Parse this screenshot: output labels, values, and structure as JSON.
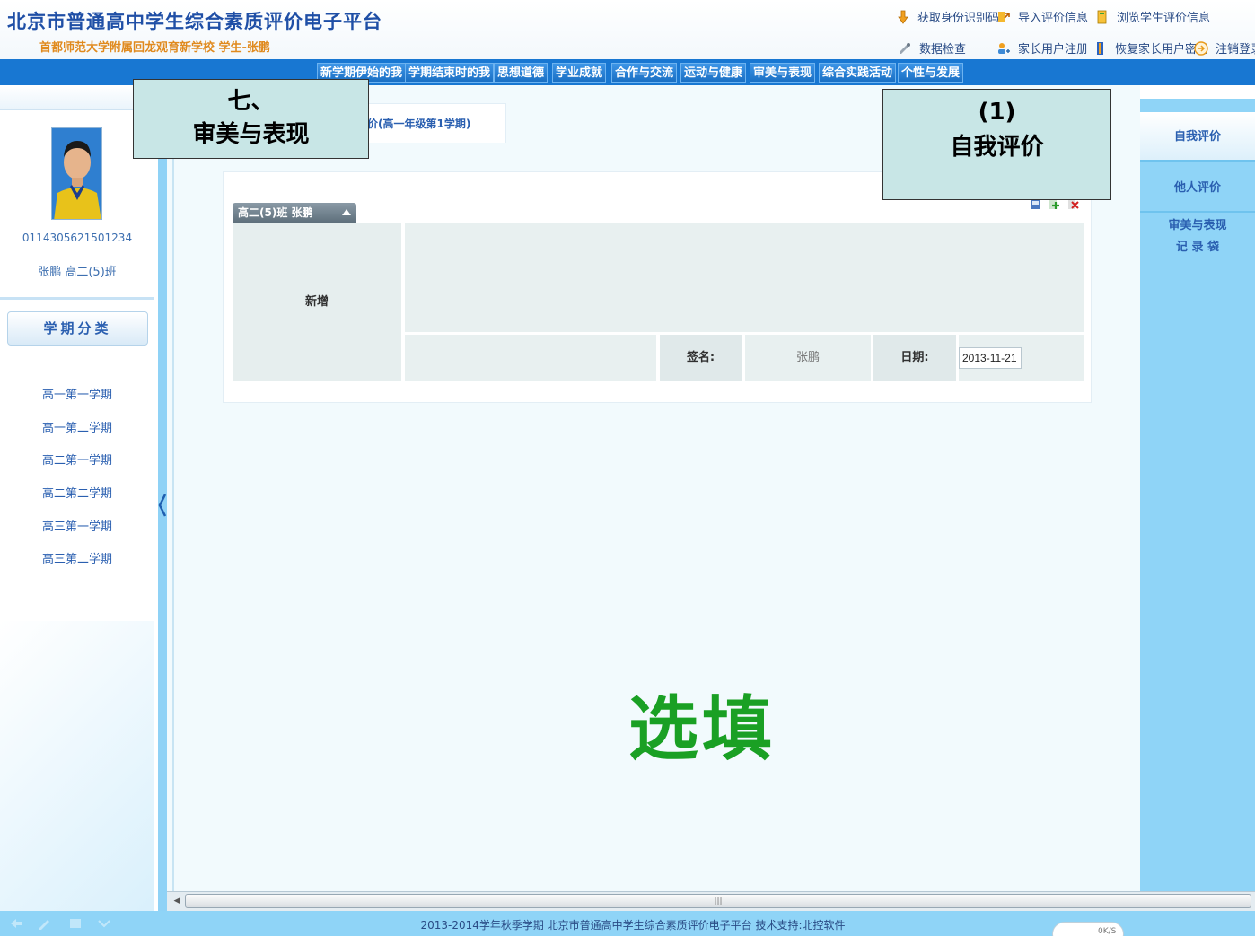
{
  "header": {
    "site_title": "北京市普通高中学生综合素质评价电子平台",
    "subtitle": "首都师范大学附属回龙观育新学校 学生-张鹏",
    "links": [
      {
        "label": "获取身份识别码",
        "icon": "hand-down-icon"
      },
      {
        "label": "导入评价信息",
        "icon": "import-icon"
      },
      {
        "label": "浏览学生评价信息",
        "icon": "book-icon"
      },
      {
        "label": "数据检查",
        "icon": "pen-check-icon"
      },
      {
        "label": "家长用户注册",
        "icon": "user-register-icon"
      },
      {
        "label": "恢复家长用户密码",
        "icon": "key-book-icon"
      },
      {
        "label": "注销登录",
        "icon": "logout-icon"
      }
    ]
  },
  "nav": {
    "items": [
      "新学期伊始的我",
      "学期结束时的我",
      "思想道德",
      "学业成就",
      "合作与交流",
      "运动与健康",
      "审美与表现",
      "综合实践活动",
      "个性与发展"
    ]
  },
  "student": {
    "id": "0114305621501234",
    "name_class": "张鹏 高二(5)班"
  },
  "term_category": {
    "title": "学期分类",
    "items": [
      "高一第一学期",
      "高一第二学期",
      "高二第一学期",
      "高二第二学期",
      "高三第一学期",
      "高三第二学期"
    ]
  },
  "main": {
    "tab_label": "价(高一年级第1学期)",
    "record_title": "高二(5)班 张鹏",
    "tool_icons": [
      "save-icon",
      "add-icon",
      "delete-icon"
    ],
    "new_label": "新增",
    "sign_label": "签名:",
    "sign_value": "张鹏",
    "date_label": "日期:",
    "date_value": "2013-11-21",
    "optional_note": "选填"
  },
  "right_sidebar": {
    "items": [
      "自我评价",
      "他人评价",
      "审美与表现",
      "记 录 袋"
    ]
  },
  "footer": {
    "text": "2013-2014学年秋季学期 北京市普通高中学生综合素质评价电子平台 技术支持:北控软件",
    "speed": "0K/S"
  },
  "callouts": {
    "category_line1": "七、",
    "category_line2": "审美与表现",
    "sub_line1": "(1)",
    "sub_line2": "自我评价"
  },
  "colors": {
    "nav_blue": "#1877d2",
    "sidebar_blue": "#8fd4f7",
    "link_blue": "#2a5fb0",
    "note_green": "#1aa024",
    "callout_bg": "#c8e6e6"
  }
}
